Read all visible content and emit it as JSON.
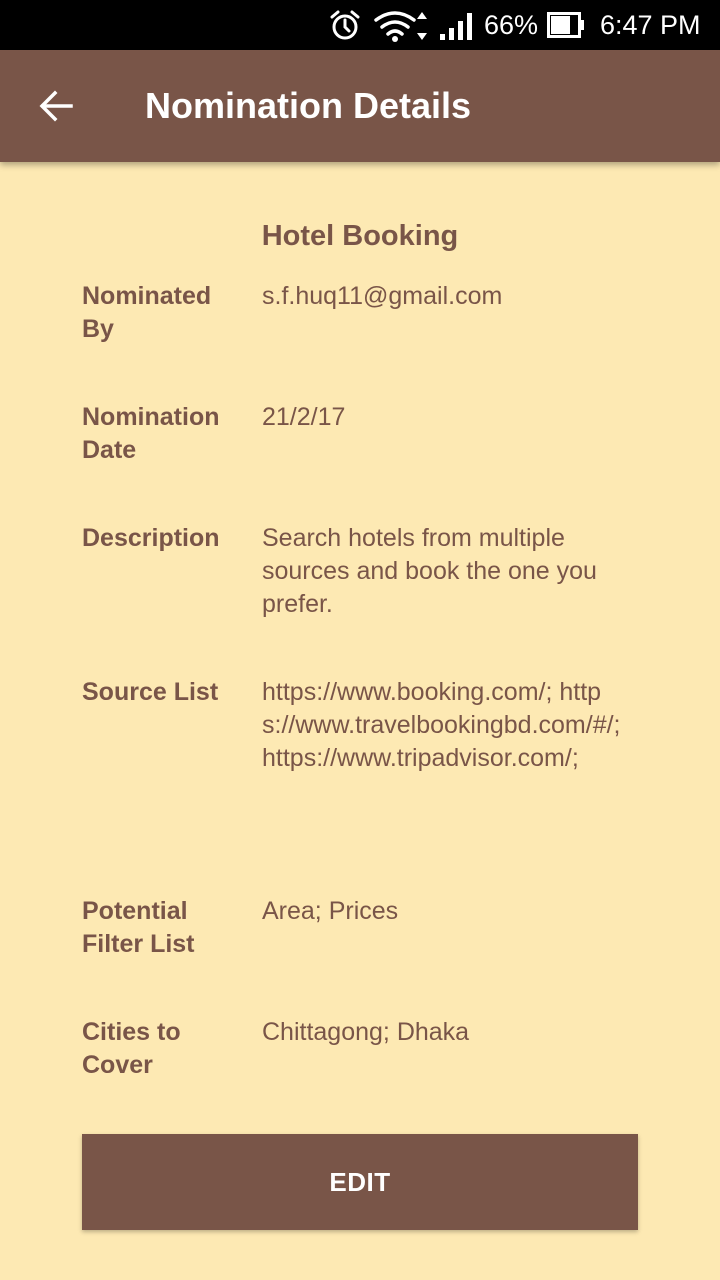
{
  "status_bar": {
    "battery": "66%",
    "time": "6:47 PM",
    "icons": [
      "alarm-icon",
      "wifi-icon",
      "signal-icon",
      "battery-icon"
    ]
  },
  "app_bar": {
    "title": "Nomination Details",
    "back_icon": "arrow-back-icon"
  },
  "nomination": {
    "title": "Hotel Booking",
    "fields": [
      {
        "label": "Nominated By",
        "value": "s.f.huq11@gmail.com"
      },
      {
        "label": "Nomination Date",
        "value": "21/2/17"
      },
      {
        "label": "Description",
        "value": "Search hotels from multiple sources and book the one you prefer."
      },
      {
        "label": "Source List",
        "value": "https://www.booking.com/; https://www.travelbookingbd.com/#/; https://www.tripadvisor.com/;"
      },
      {
        "label": "Potential Filter List",
        "value": "Area; Prices"
      },
      {
        "label": "Cities to Cover",
        "value": "Chittagong; Dhaka"
      }
    ]
  },
  "actions": {
    "edit_label": "EDIT"
  },
  "colors": {
    "primary": "#795548",
    "background": "#FDE9B3",
    "status_bar": "#000000",
    "on_primary": "#FFFFFF"
  }
}
